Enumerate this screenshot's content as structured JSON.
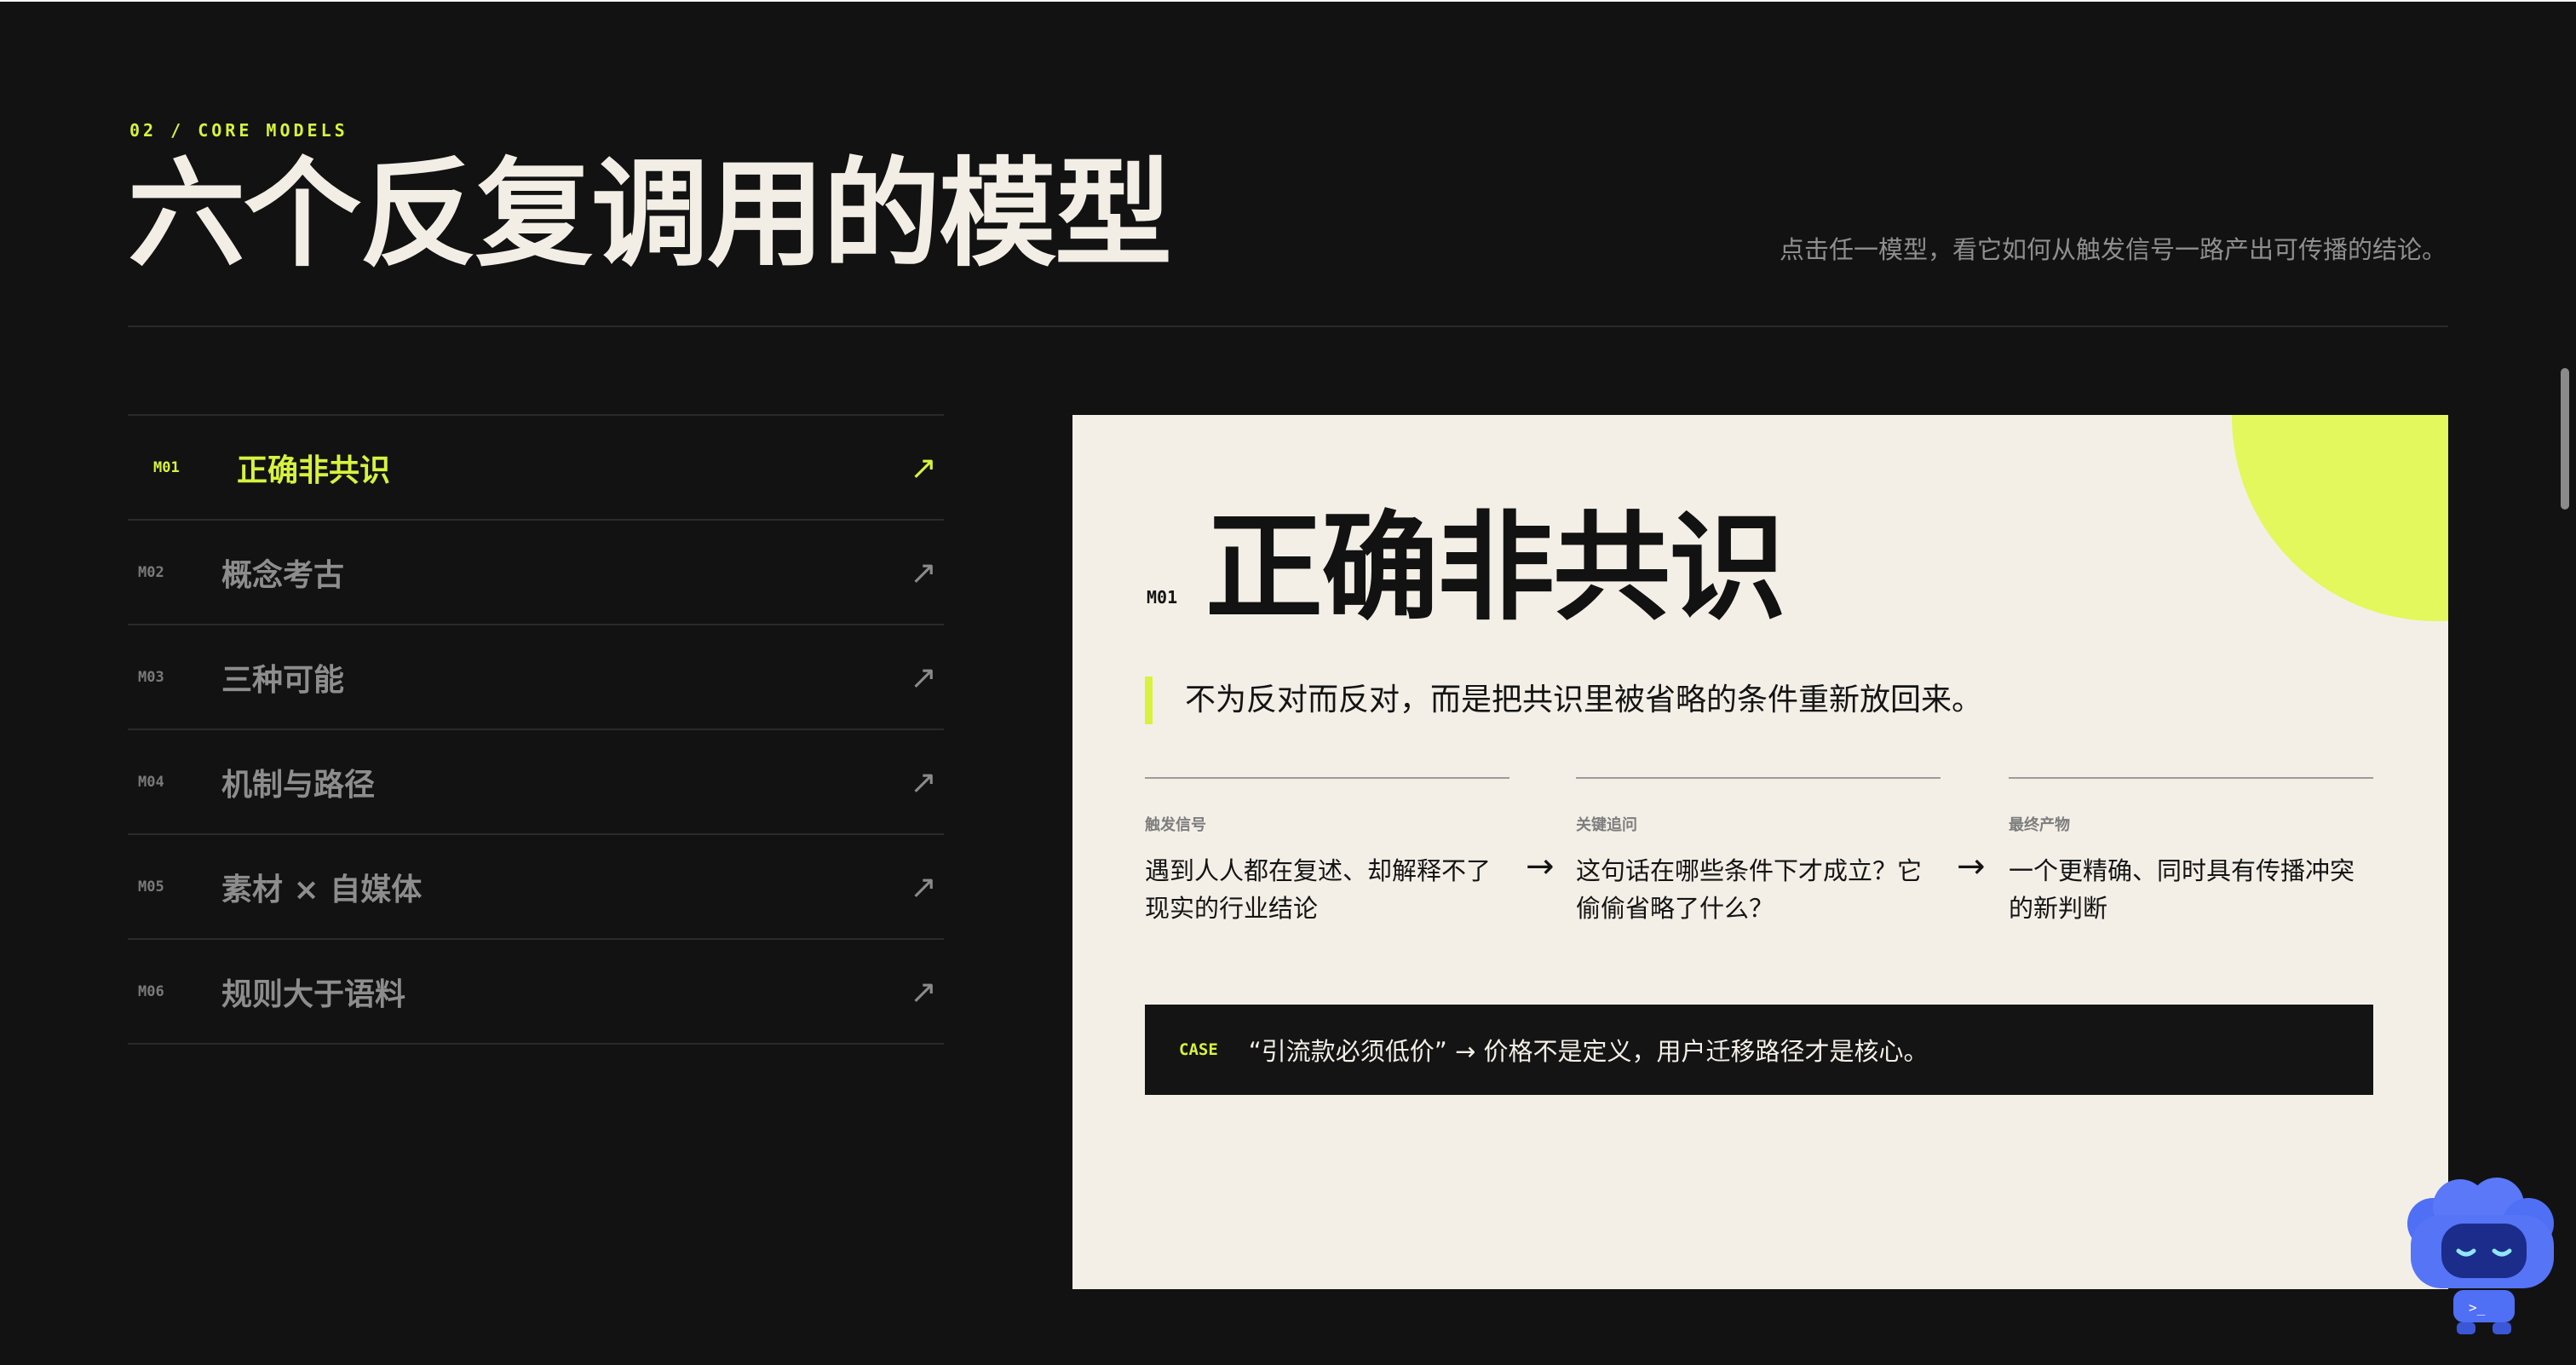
{
  "header": {
    "eyebrow": "02 / CORE MODELS",
    "title": "六个反复调用的模型",
    "subtitle": "点击任一模型，看它如何从触发信号一路产出可传播的结论。"
  },
  "models": [
    {
      "code": "M01",
      "label": "正确非共识",
      "arrow": "↗",
      "active": true
    },
    {
      "code": "M02",
      "label": "概念考古",
      "arrow": "↗",
      "active": false
    },
    {
      "code": "M03",
      "label": "三种可能",
      "arrow": "↗",
      "active": false
    },
    {
      "code": "M04",
      "label": "机制与路径",
      "arrow": "↗",
      "active": false
    },
    {
      "code": "M05",
      "label": "素材 × 自媒体",
      "arrow": "↗",
      "active": false
    },
    {
      "code": "M06",
      "label": "规则大于语料",
      "arrow": "↗",
      "active": false
    }
  ],
  "detail": {
    "code": "M01",
    "title": "正确非共识",
    "quote": "不为反对而反对，而是把共识里被省略的条件重新放回来。",
    "steps": [
      {
        "label": "触发信号",
        "text": "遇到人人都在复述、却解释不了现实的行业结论"
      },
      {
        "label": "关键追问",
        "text": "这句话在哪些条件下才成立？它偷偷省略了什么？"
      },
      {
        "label": "最终产物",
        "text": "一个更精确、同时具有传播冲突的新判断"
      }
    ],
    "step_arrow": "→",
    "case_tag": "CASE",
    "case_text": "“引流款必须低价” → 价格不是定义，用户迁移路径才是核心。"
  },
  "colors": {
    "accent": "#d7f23f",
    "background": "#121212",
    "card": "#f3efe7"
  }
}
